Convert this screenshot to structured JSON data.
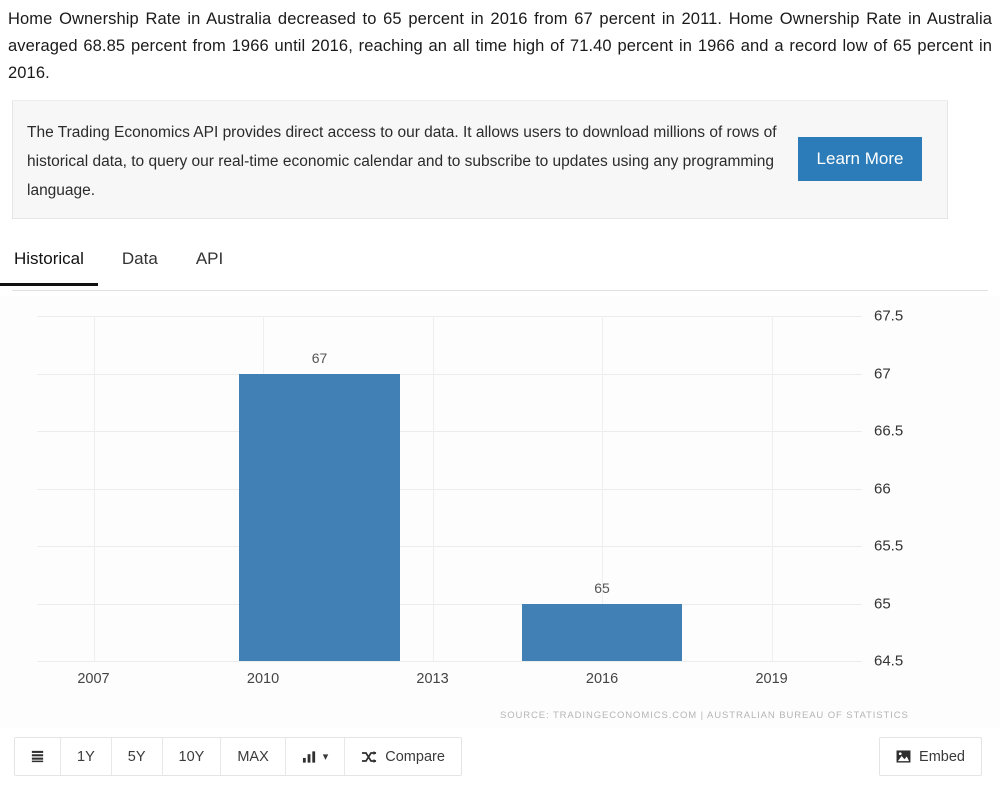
{
  "intro": {
    "paragraph": "Home Ownership Rate in Australia decreased to 65 percent in 2016 from 67 percent in 2011. Home Ownership Rate in Australia averaged 68.85 percent from 1966 until 2016, reaching an all time high of 71.40 percent in 1966 and a record low of 65 percent in 2016."
  },
  "promo": {
    "text": "The Trading Economics API provides direct access to our data. It allows users to download millions of rows of historical data, to query our real-time economic calendar and to subscribe to updates using any programming language.",
    "button_label": "Learn More",
    "button_color": "#2b7cb8"
  },
  "tabs": [
    {
      "label": "Historical",
      "active": true
    },
    {
      "label": "Data",
      "active": false
    },
    {
      "label": "API",
      "active": false
    }
  ],
  "toolbar": {
    "menu_icon": "list-icon",
    "ranges": [
      "1Y",
      "5Y",
      "10Y",
      "MAX"
    ],
    "chart_type_icon": "bar-chart-icon",
    "chart_type_caret": "▾",
    "compare_icon": "shuffle-icon",
    "compare_label": "Compare",
    "embed_icon": "image-icon",
    "embed_label": "Embed"
  },
  "chart_data": {
    "type": "bar",
    "title": "",
    "xlabel": "",
    "ylabel": "",
    "categories": [
      "2011",
      "2016"
    ],
    "values": [
      67,
      65
    ],
    "bar_color": "#4180b4",
    "ylim": [
      64.5,
      67.5
    ],
    "yticks": [
      "67.5",
      "67",
      "66.5",
      "66",
      "65.5",
      "65",
      "64.5"
    ],
    "ytick_values": [
      67.5,
      67,
      66.5,
      66,
      65.5,
      65,
      64.5
    ],
    "xticks": [
      "2007",
      "2010",
      "2013",
      "2016",
      "2019"
    ],
    "xtick_values": [
      2007,
      2010,
      2013,
      2016,
      2019
    ],
    "data_labels": [
      "67",
      "65"
    ],
    "grid": true,
    "legend": "none",
    "source": "SOURCE: TRADINGECONOMICS.COM | AUSTRALIAN BUREAU OF STATISTICS"
  }
}
